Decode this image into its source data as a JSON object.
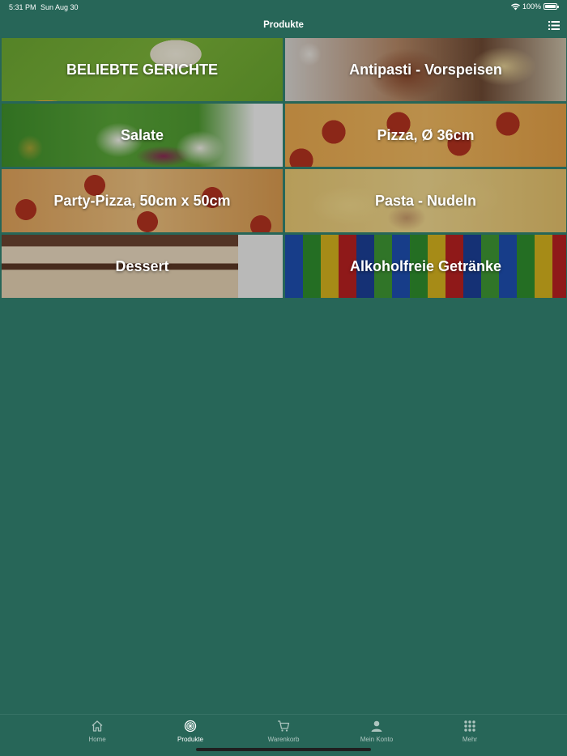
{
  "status_bar": {
    "time": "5:31 PM",
    "date": "Sun Aug 30",
    "battery": "100%"
  },
  "header": {
    "title": "Produkte",
    "list_icon": "list-icon"
  },
  "categories": [
    {
      "label": "BELIEBTE GERICHTE"
    },
    {
      "label": "Antipasti - Vorspeisen"
    },
    {
      "label": "Salate"
    },
    {
      "label": "Pizza, Ø 36cm"
    },
    {
      "label": "Party-Pizza, 50cm x 50cm"
    },
    {
      "label": "Pasta - Nudeln"
    },
    {
      "label": "Dessert"
    },
    {
      "label": "Alkoholfreie Getränke"
    }
  ],
  "tab_bar": {
    "active": "Produkte",
    "tabs": [
      {
        "label": "Home",
        "icon": "home-icon"
      },
      {
        "label": "Produkte",
        "icon": "pizza-icon"
      },
      {
        "label": "Warenkorb",
        "icon": "cart-icon"
      },
      {
        "label": "Mein Konto",
        "icon": "person-icon"
      },
      {
        "label": "Mehr",
        "icon": "grid-dots-icon"
      }
    ]
  },
  "colors": {
    "background": "#276658",
    "text": "#ffffff"
  }
}
